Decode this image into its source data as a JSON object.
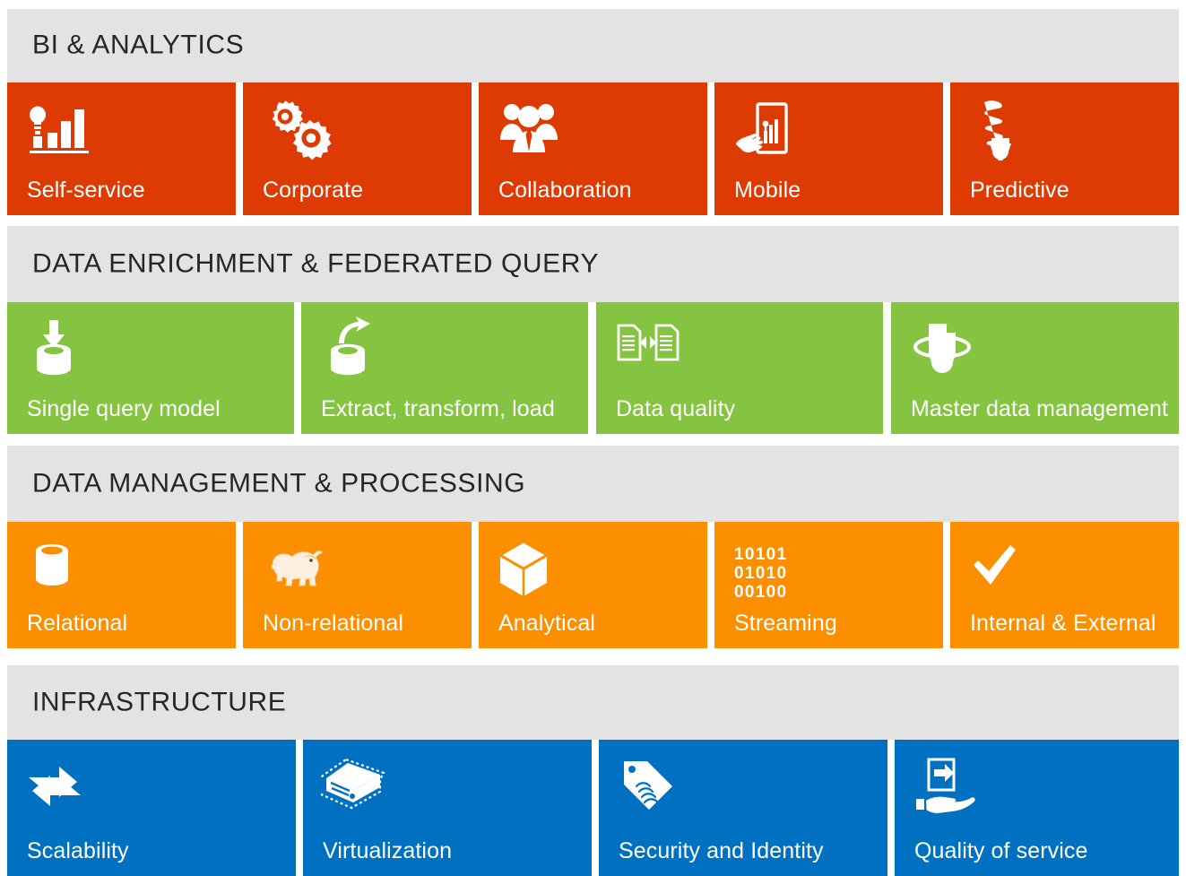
{
  "palette": {
    "band_bg": "#e3e3e3",
    "band_text": "#262626",
    "page_bg": "#ffffff",
    "bi_analytics": "#dd3b03",
    "data_enrichment": "#82c council",
    "data_management": "#fc8f00",
    "infrastructure": "#0071c1",
    "tile_text": "#ffffff"
  },
  "sections": [
    {
      "id": "bi-analytics",
      "title": "BI & ANALYTICS",
      "color": "#dd3b03",
      "tiles": [
        {
          "label": "Self-service",
          "icon": "bar-chart-idea-icon"
        },
        {
          "label": "Corporate",
          "icon": "gears-icon"
        },
        {
          "label": "Collaboration",
          "icon": "people-group-icon"
        },
        {
          "label": "Mobile",
          "icon": "mobile-chart-touch-icon"
        },
        {
          "label": "Predictive",
          "icon": "light-bulb-spiral-icon"
        }
      ]
    },
    {
      "id": "data-enrichment",
      "title": "DATA ENRICHMENT & FEDERATED QUERY",
      "color": "#84c440",
      "tiles": [
        {
          "label": "Single query model",
          "icon": "database-import-icon"
        },
        {
          "label": "Extract, transform, load",
          "icon": "database-export-icon"
        },
        {
          "label": "Data quality",
          "icon": "two-documents-compare-icon"
        },
        {
          "label": "Master data management",
          "icon": "document-orbit-icon"
        }
      ]
    },
    {
      "id": "data-management",
      "title": "DATA MANAGEMENT & PROCESSING",
      "color": "#fc8f00",
      "tiles": [
        {
          "label": "Relational",
          "icon": "database-cylinder-icon"
        },
        {
          "label": "Non-relational",
          "icon": "hadoop-elephant-icon"
        },
        {
          "label": "Analytical",
          "icon": "cube-icon"
        },
        {
          "label": "Streaming",
          "icon": "binary-stream-icon",
          "binary_lines": [
            "10101",
            "01010",
            "00100"
          ]
        },
        {
          "label": "Internal & External",
          "icon": "checkmark-icon"
        }
      ]
    },
    {
      "id": "infrastructure",
      "title": "INFRASTRUCTURE",
      "color": "#0071c1",
      "tiles": [
        {
          "label": "Scalability",
          "icon": "two-arrows-exchange-icon"
        },
        {
          "label": "Virtualization",
          "icon": "server-dashed-icon"
        },
        {
          "label": "Security and Identity",
          "icon": "tag-fingerprint-icon"
        },
        {
          "label": "Quality of service",
          "icon": "hand-deliver-icon"
        }
      ]
    }
  ]
}
